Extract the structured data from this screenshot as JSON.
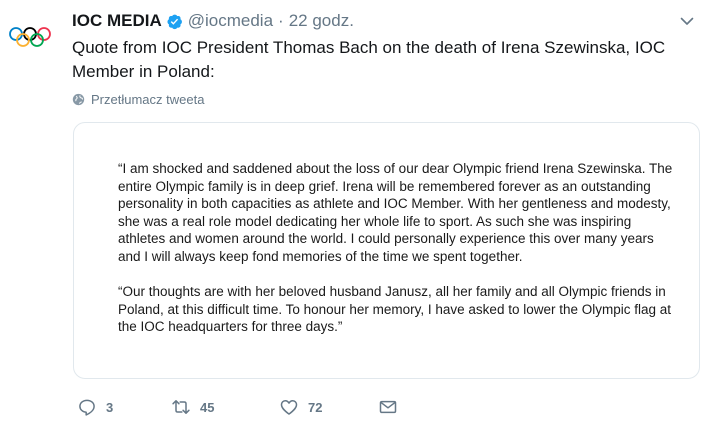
{
  "tweet": {
    "author_name": "IOC MEDIA",
    "handle": "@iocmedia",
    "separator": "·",
    "time": "22 godz.",
    "text": "Quote from IOC President Thomas Bach on the death of Irena Szewinska, IOC Member in Poland:",
    "translate_label": "Przetłumacz tweeta"
  },
  "quote_image": {
    "paragraph_1": "“I am shocked and saddened about the loss of our dear Olympic friend Irena Szewinska. The entire Olympic family is in deep grief. Irena will be remembered forever as an outstanding personality in both capacities as athlete and IOC Member. With her gentleness and modesty, she was a real role model dedicating her whole life to sport. As such she was inspiring athletes and women around the world. I could personally experience this over many years and I will always keep fond memories of the time we spent together.",
    "paragraph_2": "“Our thoughts are with her beloved husband Janusz, all her family and all Olympic friends in Poland, at this difficult time. To honour her memory, I have asked to lower the Olympic flag at the IOC headquarters for three days.”"
  },
  "actions": {
    "reply_count": "3",
    "retweet_count": "45",
    "like_count": "72"
  },
  "icons": {
    "avatar": "olympic-rings-icon",
    "verified": "verified-badge-icon",
    "caret": "chevron-down-icon",
    "translate": "globe-icon",
    "reply": "reply-icon",
    "retweet": "retweet-icon",
    "like": "heart-icon",
    "dm": "envelope-icon"
  },
  "colors": {
    "text": "#14171a",
    "secondary": "#657786",
    "verified": "#1da1f2",
    "ring_blue": "#0081c8",
    "ring_black": "#000000",
    "ring_red": "#ee334e",
    "ring_yellow": "#fcb131",
    "ring_green": "#00a651"
  }
}
